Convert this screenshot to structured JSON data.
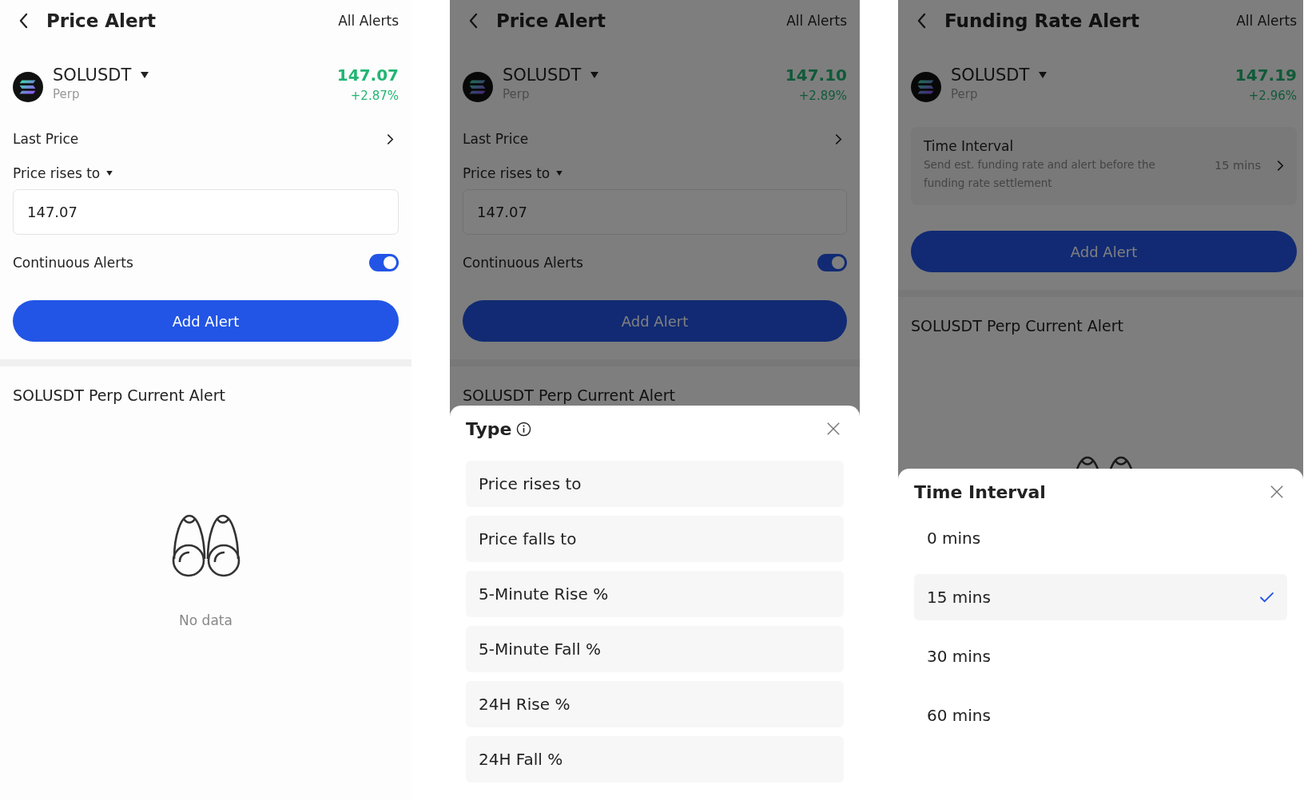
{
  "screens": [
    {
      "title": "Price Alert",
      "all_alerts": "All Alerts",
      "symbol": "SOLUSDT",
      "market": "Perp",
      "price": "147.07",
      "change": "+2.87%",
      "form": {
        "kind": "price",
        "source": "Last Price",
        "condition": "Price rises to",
        "value": "147.07",
        "continuous": {
          "label": "Continuous Alerts",
          "on": true
        }
      },
      "button": "Add Alert",
      "section_title": "SOLUSDT Perp Current Alert",
      "empty": {
        "kind": "binoculars",
        "text": "No data"
      }
    },
    {
      "title": "Price Alert",
      "all_alerts": "All Alerts",
      "symbol": "SOLUSDT",
      "market": "Perp",
      "price": "147.10",
      "change": "+2.89%",
      "form": {
        "kind": "price",
        "source": "Last Price",
        "condition": "Price rises to",
        "value": "147.07",
        "continuous": {
          "label": "Continuous Alerts",
          "on": true
        }
      },
      "button": "Add Alert",
      "section_title": "SOLUSDT Perp Current Alert",
      "sheet": {
        "kind": "type",
        "title": "Type",
        "options": [
          {
            "label": "Price rises to"
          },
          {
            "label": "Price falls to"
          },
          {
            "label": "5-Minute Rise %"
          },
          {
            "label": "5-Minute Fall %"
          },
          {
            "label": "24H Rise %"
          },
          {
            "label": "24H Fall %"
          }
        ]
      }
    },
    {
      "title": "Funding Rate Alert",
      "all_alerts": "All Alerts",
      "symbol": "SOLUSDT",
      "market": "Perp",
      "price": "147.19",
      "change": "+2.96%",
      "form": {
        "kind": "funding",
        "label": "Time Interval",
        "description": "Send est. funding rate and alert before the funding rate settlement",
        "value": "15 mins"
      },
      "button": "Add Alert",
      "section_title": "SOLUSDT Perp Current Alert",
      "empty": {
        "kind": "binoculars"
      },
      "sheet": {
        "kind": "interval",
        "title": "Time Interval",
        "options": [
          {
            "label": "0 mins",
            "selected": false
          },
          {
            "label": "15 mins",
            "selected": true
          },
          {
            "label": "30 mins",
            "selected": false
          },
          {
            "label": "60 mins",
            "selected": false
          }
        ]
      }
    }
  ]
}
